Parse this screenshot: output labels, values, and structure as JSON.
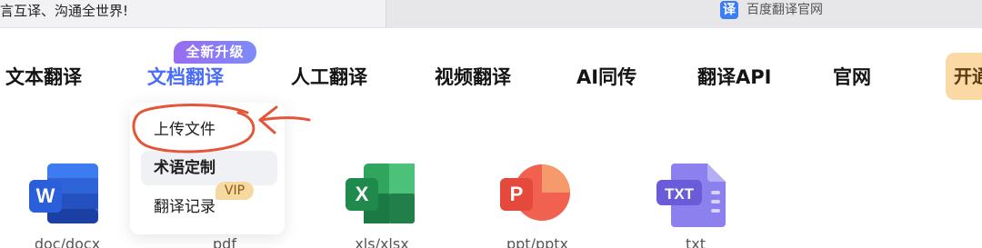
{
  "browser": {
    "left_tab_text": "言互译、沟通全世界!",
    "right_tab_icon_char": "译",
    "right_tab_title": "百度翻译官网"
  },
  "nav": {
    "items": [
      {
        "label": "文本翻译"
      },
      {
        "label": "文档翻译",
        "active": true
      },
      {
        "label": "人工翻译"
      },
      {
        "label": "视频翻译"
      },
      {
        "label": "AI同传"
      },
      {
        "label": "翻译API"
      },
      {
        "label": "官网"
      }
    ],
    "new_badge": "全新升级",
    "open_button": "开通"
  },
  "dropdown": {
    "items": [
      {
        "label": "上传文件"
      },
      {
        "label": "术语定制"
      },
      {
        "label": "翻译记录"
      }
    ],
    "vip_badge": "VIP"
  },
  "file_types": [
    {
      "label": "doc/docx",
      "icon": "word-icon",
      "letter": "W",
      "color": "#2b5fd9"
    },
    {
      "label": "pdf",
      "icon": "pdf-icon",
      "letter": "",
      "color": "#e24b4b"
    },
    {
      "label": "xls/xlsx",
      "icon": "excel-icon",
      "letter": "X",
      "color": "#1f8a4c"
    },
    {
      "label": "ppt/pptx",
      "icon": "powerpoint-icon",
      "letter": "P",
      "color": "#e5493b"
    },
    {
      "label": "txt",
      "icon": "txt-icon",
      "letter": "TXT",
      "color": "#6a5cd8"
    }
  ],
  "colors": {
    "accent": "#4a6cf7",
    "annotation": "#e4553a"
  }
}
